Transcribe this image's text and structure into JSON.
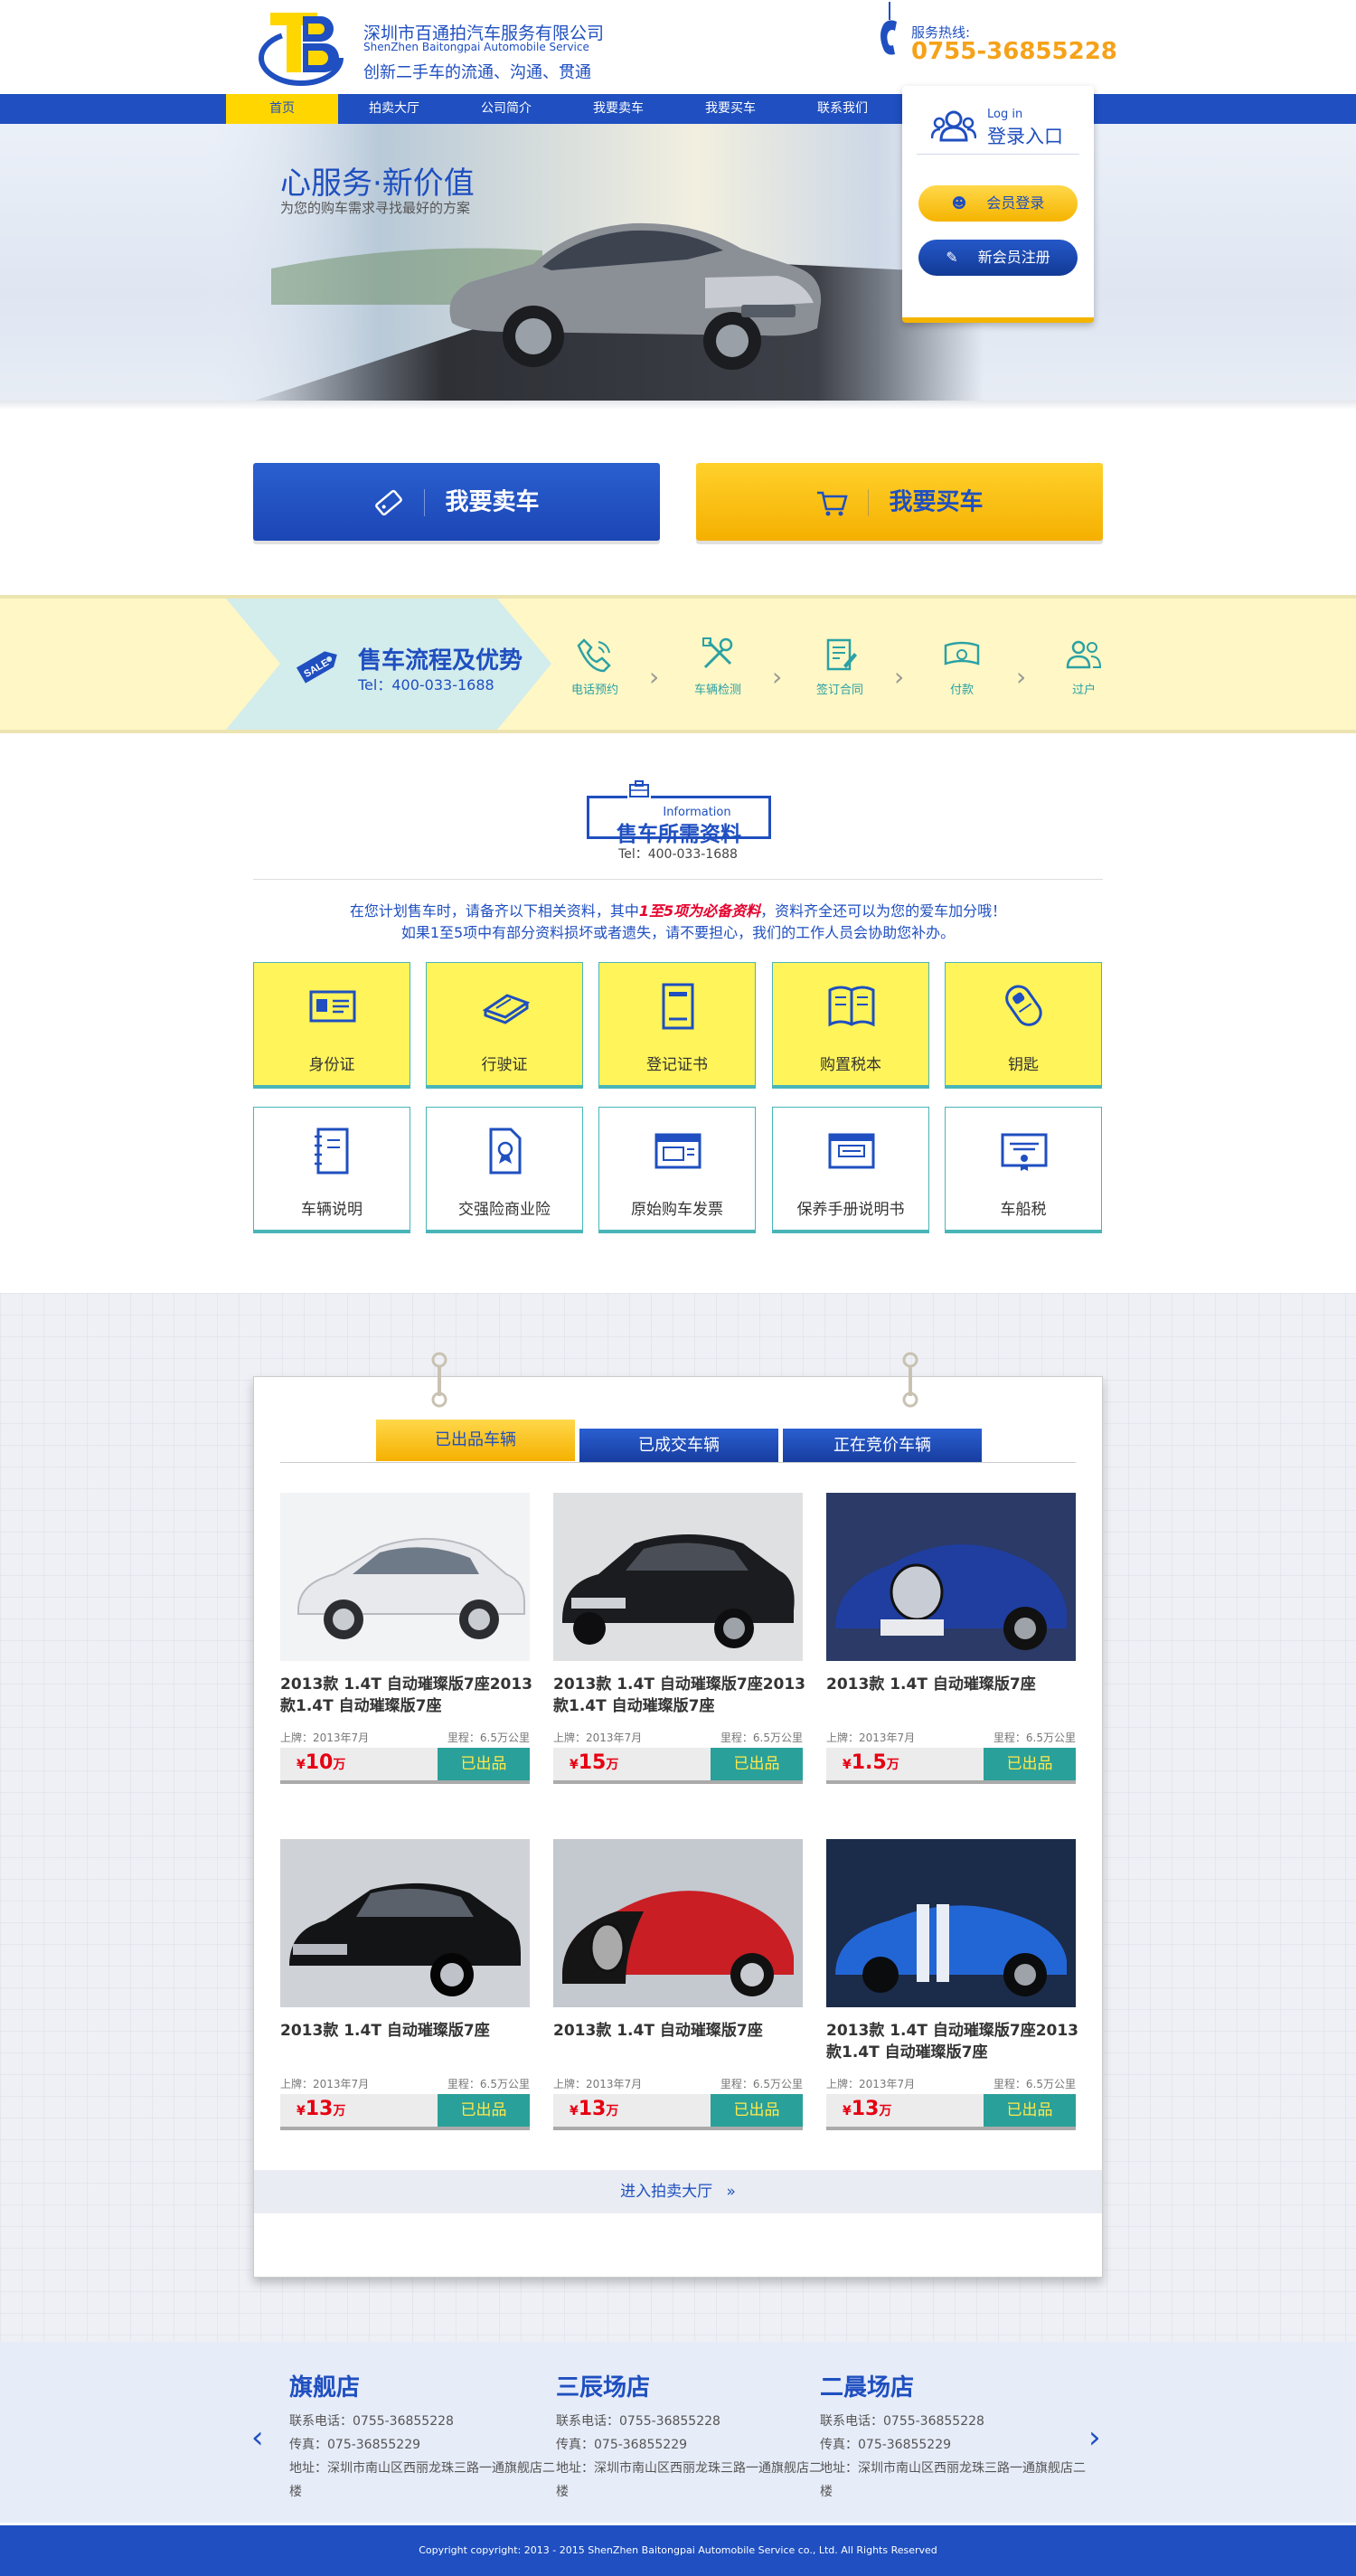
{
  "header": {
    "company_cn": "深圳市百通拍汽车服务有限公司",
    "company_en": "ShenZhen Baitongpai Automobile Service",
    "slogan": "创新二手车的流通、沟通、贯通",
    "hotline_label": "服务热线:",
    "hotline_number": "0755-36855228"
  },
  "nav": {
    "items": [
      "首页",
      "拍卖大厅",
      "公司简介",
      "我要卖车",
      "我要买车",
      "联系我们"
    ],
    "active_index": 0
  },
  "banner": {
    "title": "心服务·新价值",
    "subtitle": "为您的购车需求寻找最好的方案"
  },
  "login": {
    "title_en": "Log in",
    "title_cn": "登录入口",
    "member_login": "会员登录",
    "member_register": "新会员注册"
  },
  "actions": {
    "sell": "我要卖车",
    "buy": "我要买车"
  },
  "process": {
    "title": "售车流程及优势",
    "tel": "Tel：400-033-1688",
    "sale_tag": "SALE",
    "steps": [
      "电话预约",
      "车辆检测",
      "签订合同",
      "付款",
      "过户"
    ]
  },
  "info": {
    "title_en": "Information",
    "title_cn": "售车所需资料",
    "tel": "Tel：400-033-1688",
    "note1_a": "在您计划售车时，请备齐以下相关资料，其中",
    "note1_hl": "1至5项为必备资料",
    "note1_b": "，资料齐全还可以为您的爱车加分哦！",
    "note2": "如果1至5项中有部分资料损坏或者遗失，请不要担心，我们的工作人员会协助您补办。",
    "docs": [
      "身份证",
      "行驶证",
      "登记证书",
      "购置税本",
      "钥匙",
      "车辆说明",
      "交强险商业险",
      "原始购车发票",
      "保养手册说明书",
      "车船税"
    ]
  },
  "gallery": {
    "tabs": [
      "已出品车辆",
      "已成交车辆",
      "正在竞价车辆"
    ],
    "cars": [
      {
        "title": "2013款 1.4T 自动璀璨版7座2013款1.4T 自动璀璨版7座",
        "year": "上牌：2013年7月",
        "mileage": "里程：6.5万公里",
        "price": "10",
        "unit": "万",
        "status": "已出品"
      },
      {
        "title": "2013款 1.4T 自动璀璨版7座2013款1.4T 自动璀璨版7座",
        "year": "上牌：2013年7月",
        "mileage": "里程：6.5万公里",
        "price": "15",
        "unit": "万",
        "status": "已出品"
      },
      {
        "title": "2013款 1.4T 自动璀璨版7座",
        "year": "上牌：2013年7月",
        "mileage": "里程：6.5万公里",
        "price": "1.5",
        "unit": "万",
        "status": "已出品"
      },
      {
        "title": "2013款 1.4T 自动璀璨版7座",
        "year": "上牌：2013年7月",
        "mileage": "里程：6.5万公里",
        "price": "13",
        "unit": "万",
        "status": "已出品"
      },
      {
        "title": "2013款 1.4T 自动璀璨版7座",
        "year": "上牌：2013年7月",
        "mileage": "里程：6.5万公里",
        "price": "13",
        "unit": "万",
        "status": "已出品"
      },
      {
        "title": "2013款 1.4T 自动璀璨版7座2013款1.4T 自动璀璨版7座",
        "year": "上牌：2013年7月",
        "mileage": "里程：6.5万公里",
        "price": "13",
        "unit": "万",
        "status": "已出品"
      }
    ],
    "enter_hall": "进入拍卖大厅"
  },
  "stores": [
    {
      "name": "旗舰店",
      "phone": "联系电话：0755-36855228",
      "fax": "传真：075-36855229",
      "address": "地址：深圳市南山区西丽龙珠三路一通旗舰店二楼"
    },
    {
      "name": "三辰场店",
      "phone": "联系电话：0755-36855228",
      "fax": "传真：075-36855229",
      "address": "地址：深圳市南山区西丽龙珠三路一通旗舰店二楼"
    },
    {
      "name": "二晨场店",
      "phone": "联系电话：0755-36855228",
      "fax": "传真：075-36855229",
      "address": "地址：深圳市南山区西丽龙珠三路一通旗舰店二楼"
    }
  ],
  "footer": {
    "copyright": "Copyright copyright: 2013 - 2015 ShenZhen Baitongpai Automobile Service co., Ltd. All Rights Reserved"
  },
  "colors": {
    "brand_blue": "#1f4fc0",
    "brand_yellow": "#ffd600",
    "teal": "#2aa09a",
    "price_red": "#e60012"
  },
  "icons": [
    "phone-icon",
    "users-icon",
    "user-icon",
    "pen-icon",
    "tag-icon",
    "cart-icon",
    "sale-tag-icon",
    "id-card-icon",
    "license-icon",
    "certificate-icon",
    "book-icon",
    "key-icon",
    "chevron-left-icon",
    "chevron-right-icon",
    "double-chevron-icon"
  ]
}
